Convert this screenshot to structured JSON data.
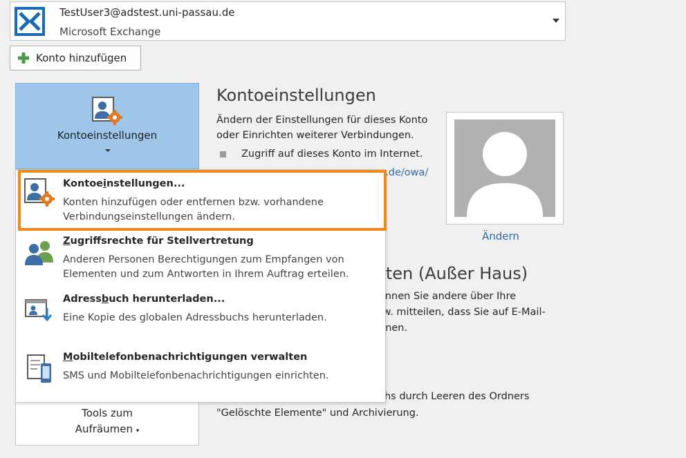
{
  "account": {
    "email": "TestUser3@adstest.uni-passau.de",
    "type": "Microsoft Exchange"
  },
  "add_account_label": "Konto hinzufügen",
  "account_settings_button": {
    "label": "Kontoeinstellungen"
  },
  "tools_button": {
    "line1": "Tools zum",
    "line2": "Aufräumen"
  },
  "section": {
    "title": "Kontoeinstellungen",
    "desc_line1": "Ändern der Einstellungen für dieses Konto",
    "desc_line2": "oder Einrichten weiterer Verbindungen.",
    "bullet": "Zugriff auf dieses Konto im Internet.",
    "link_fragment": "u.de/owa/"
  },
  "profile": {
    "change_label": "Ändern"
  },
  "oof": {
    "title_fragment": "rten (Außer Haus)",
    "line1": "önnen Sie andere über Ihre",
    "line2": "tw. mitteilen, dass Sie auf E-Mail-",
    "line3": "nnen."
  },
  "cleanup": {
    "line1": "chs durch Leeren des Ordners",
    "line2": "\"Gelöschte Elemente\" und Archivierung."
  },
  "menu": {
    "items": [
      {
        "title_pre": "Kontoe",
        "title_u": "i",
        "title_post": "nstellungen...",
        "desc1": "Konten hinzufügen oder entfernen bzw. vorhandene",
        "desc2": "Verbindungseinstellungen ändern."
      },
      {
        "title_pre": "",
        "title_u": "Z",
        "title_post": "ugriffsrechte für Stellvertretung",
        "desc1": "Anderen Personen Berechtigungen zum Empfangen von",
        "desc2": "Elementen und zum Antworten in Ihrem Auftrag erteilen."
      },
      {
        "title_pre": "Adress",
        "title_u": "b",
        "title_post": "uch herunterladen...",
        "desc1": "Eine Kopie des globalen Adressbuchs herunterladen."
      },
      {
        "title_pre": "",
        "title_u": "M",
        "title_post": "obiltelefonbenachrichtigungen verwalten",
        "desc1": "SMS und Mobiltelefonbenachrichtigungen einrichten."
      }
    ]
  },
  "colors": {
    "highlight": "#f0891a",
    "selected_button": "#9dc6e8",
    "link": "#2b6ca3",
    "exchange_blue": "#1a6bb5"
  }
}
